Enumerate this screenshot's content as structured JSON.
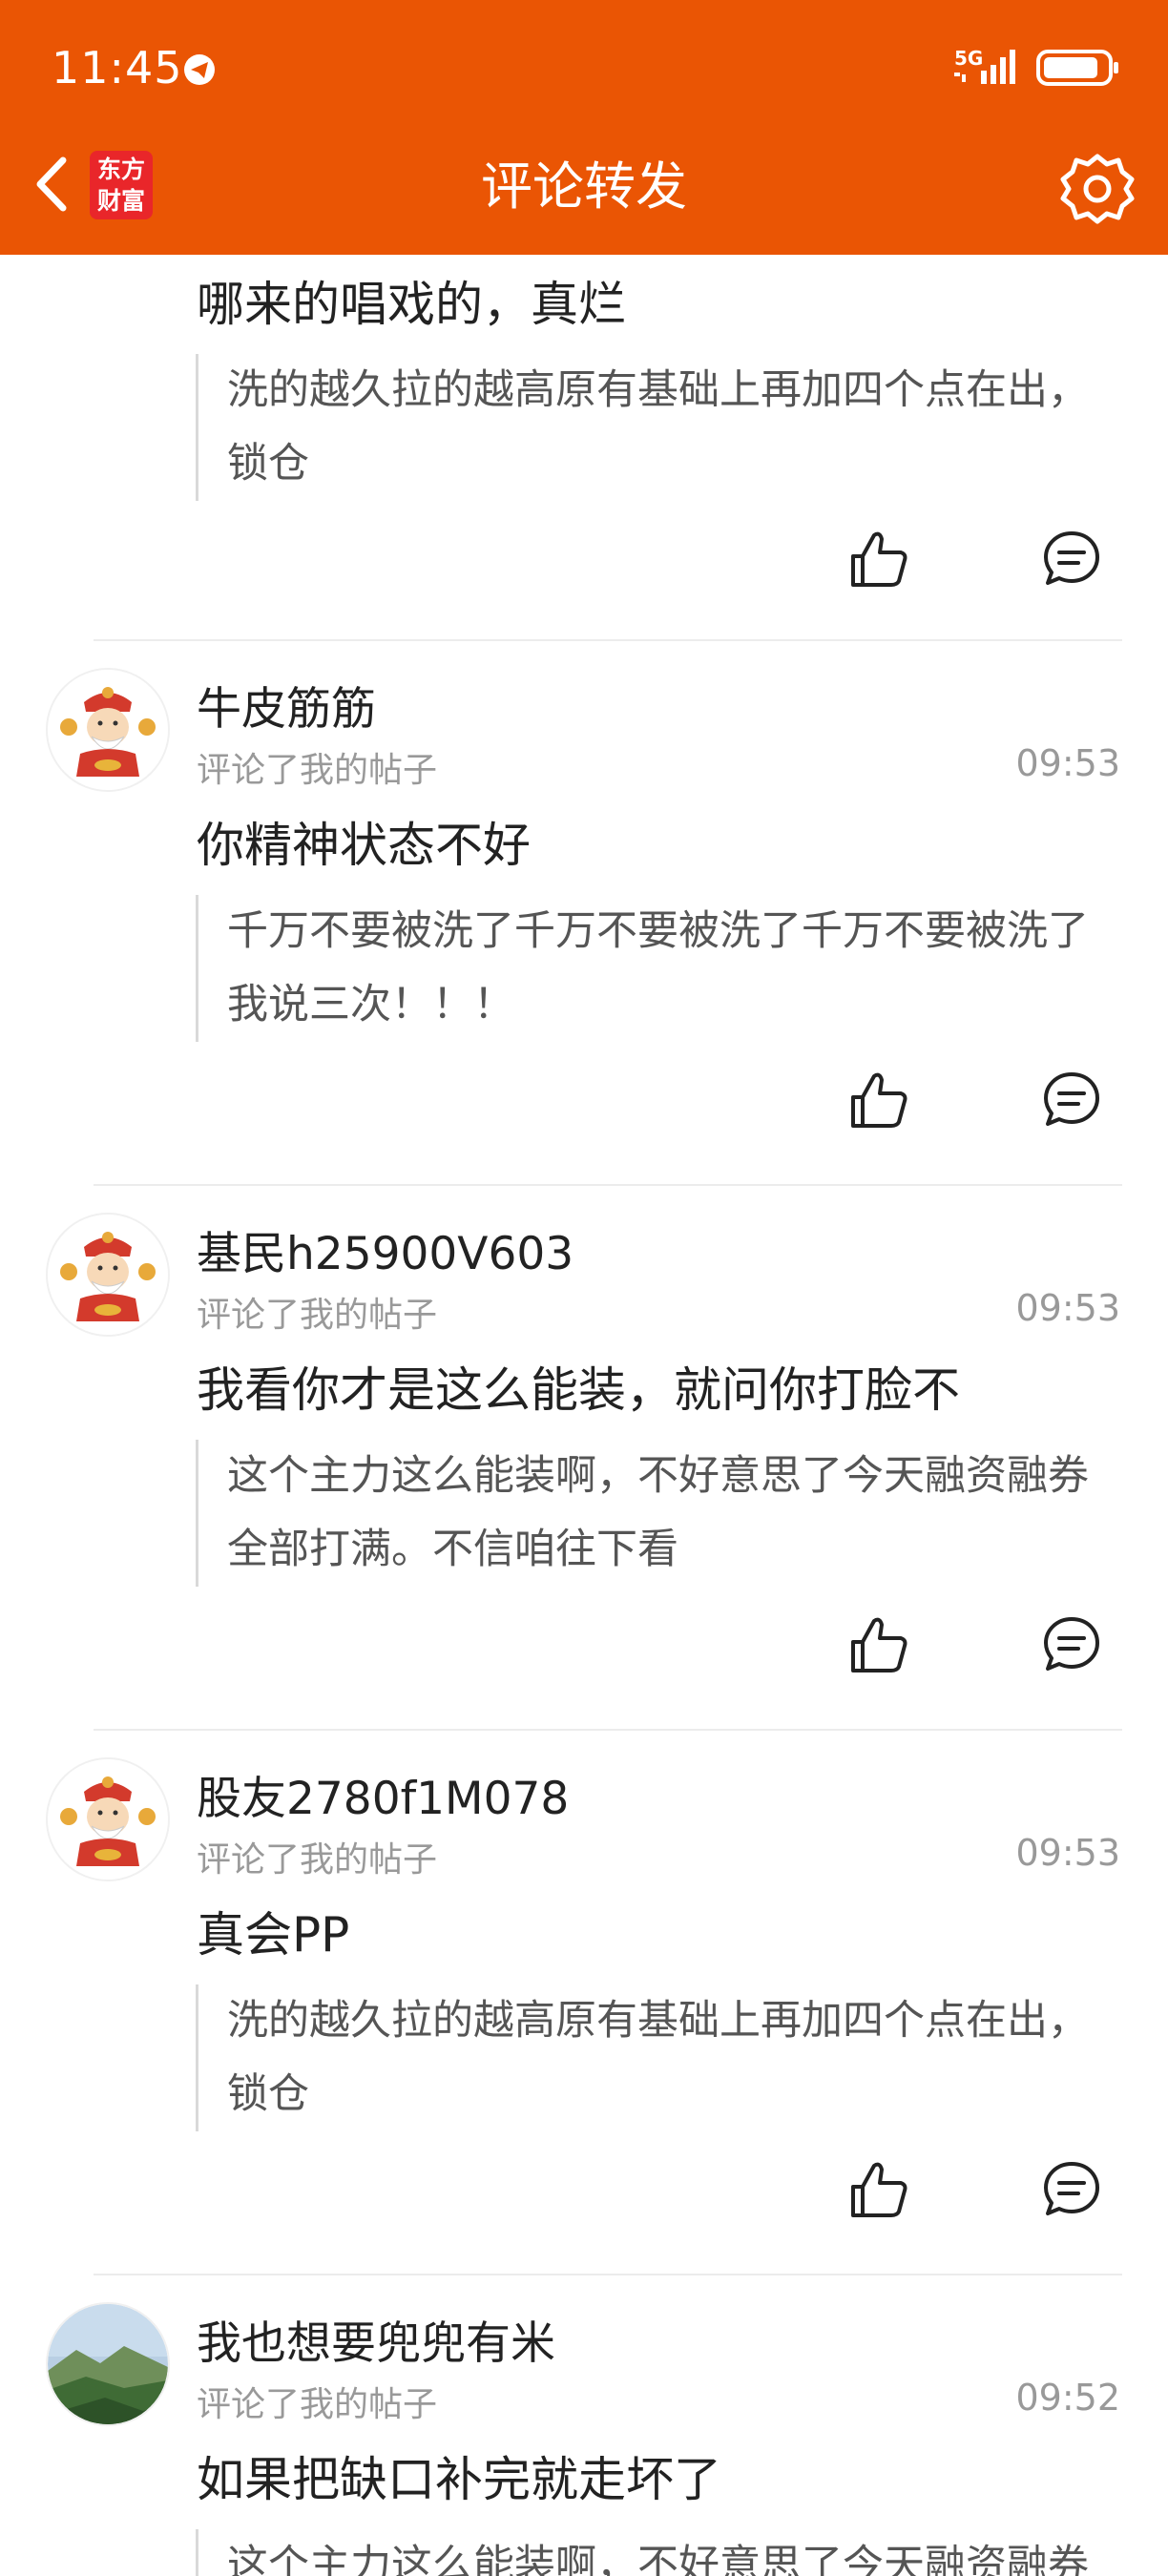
{
  "status_bar": {
    "time": "11:45",
    "network": "5G"
  },
  "header": {
    "title": "评论转发",
    "brand_line1": "东方",
    "brand_line2": "财富"
  },
  "colors": {
    "brand": "#ea5504",
    "logo_red": "#e9262a"
  },
  "icons": {
    "back": "chevron-left-icon",
    "settings": "gear-icon",
    "like": "thumbs-up-icon",
    "reply": "comment-bubble-icon"
  },
  "comments": [
    {
      "reply": "哪来的唱戏的，真烂",
      "quote": "洗的越久拉的越高原有基础上再加四个点在出，锁仓"
    },
    {
      "user": "牛皮筋筋",
      "action": "评论了我的帖子",
      "time": "09:53",
      "reply": "你精神状态不好",
      "quote": "千万不要被洗了千万不要被洗了千万不要被洗了我说三次！！！"
    },
    {
      "user": "基民h25900V603",
      "action": "评论了我的帖子",
      "time": "09:53",
      "reply": "我看你才是这么能装，就问你打脸不",
      "quote": "这个主力这么能装啊，不好意思了今天融资融券全部打满。不信咱往下看"
    },
    {
      "user": "股友2780f1M078",
      "action": "评论了我的帖子",
      "time": "09:53",
      "reply": "真会PP",
      "quote": "洗的越久拉的越高原有基础上再加四个点在出，锁仓"
    },
    {
      "user": "我也想要兜兜有米",
      "action": "评论了我的帖子",
      "time": "09:52",
      "reply": "如果把缺口补完就走坏了",
      "quote": "这个主力这么能装啊，不好意思了今天融资融券全部打满。不信咱往下看"
    }
  ]
}
